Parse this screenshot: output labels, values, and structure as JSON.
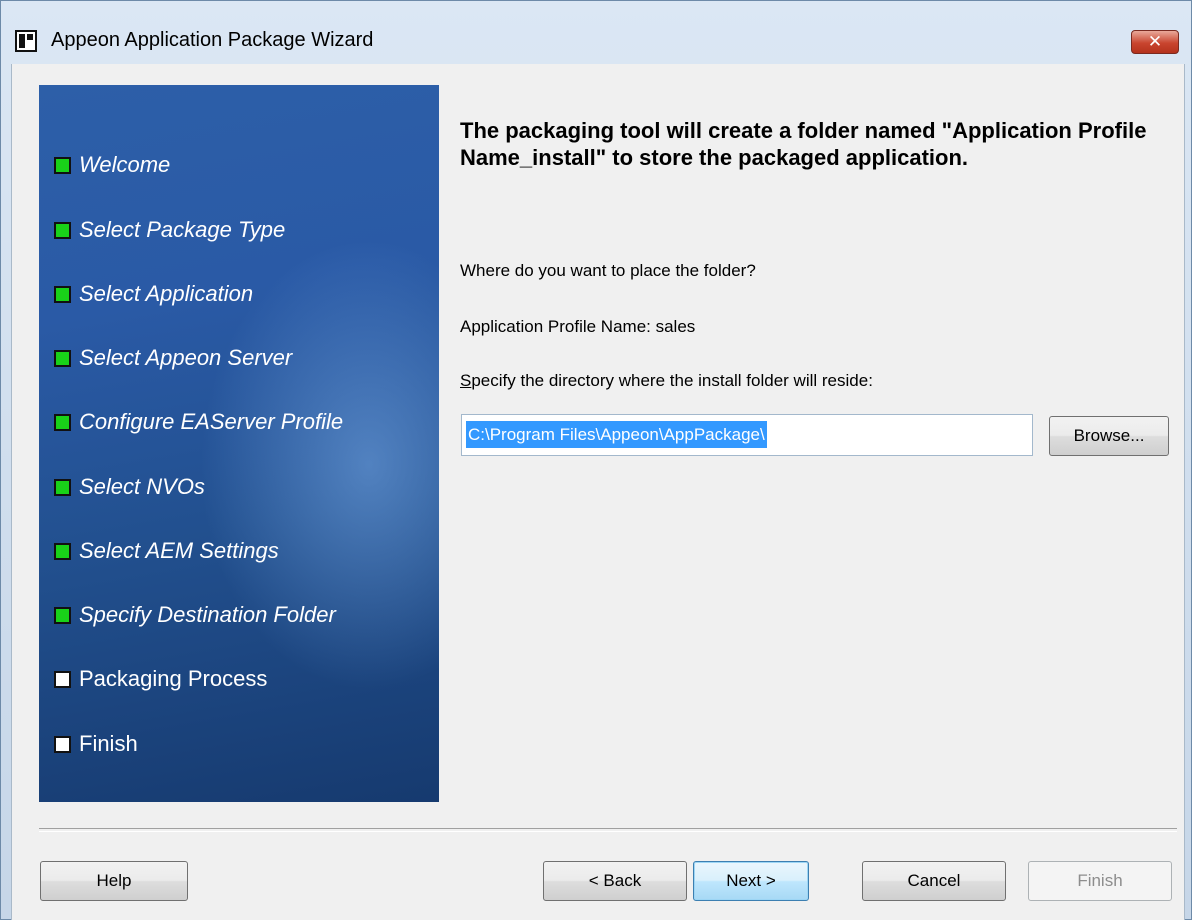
{
  "window": {
    "title": "Appeon Application Package Wizard",
    "close_label": "✕"
  },
  "sidebar": {
    "steps": [
      {
        "label": "Welcome",
        "status": "done"
      },
      {
        "label": "Select Package Type",
        "status": "done"
      },
      {
        "label": "Select Application",
        "status": "done"
      },
      {
        "label": "Select Appeon Server",
        "status": "done"
      },
      {
        "label": "Configure EAServer Profile",
        "status": "done"
      },
      {
        "label": "Select NVOs",
        "status": "done"
      },
      {
        "label": "Select AEM Settings",
        "status": "done"
      },
      {
        "label": "Specify Destination Folder",
        "status": "done"
      },
      {
        "label": "Packaging Process",
        "status": "pending"
      },
      {
        "label": "Finish",
        "status": "pending"
      }
    ]
  },
  "main": {
    "heading": "The packaging tool will create a folder named \"Application Profile Name_install\" to store the packaged application.",
    "question": "Where do you want to place the folder?",
    "profile_label": "Application Profile Name: sales",
    "directory_prompt_first": "S",
    "directory_prompt_rest": "pecify the directory where the install folder will reside:",
    "directory_value": "C:\\Program Files\\Appeon\\AppPackage\\",
    "browse_label": "Browse..."
  },
  "buttons": {
    "help": "Help",
    "back": "< Back",
    "next": "Next >",
    "cancel": "Cancel",
    "finish": "Finish"
  },
  "colors": {
    "step_done": "#19d219",
    "step_pending": "#ffffff",
    "selection": "#3399ff"
  }
}
